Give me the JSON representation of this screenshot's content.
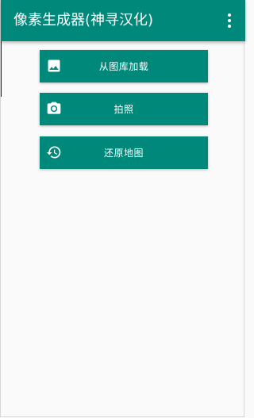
{
  "app": {
    "title": "像素生成器(神寻汉化)"
  },
  "toolbar": {
    "menu_icon": "more-vert-icon"
  },
  "actions": [
    {
      "label": "从图库加载",
      "icon": "image-icon"
    },
    {
      "label": "拍照",
      "icon": "camera-icon"
    },
    {
      "label": "还原地图",
      "icon": "restore-icon"
    }
  ],
  "colors": {
    "primary": "#00897b",
    "background": "#fafafa",
    "on_primary": "#ffffff"
  }
}
